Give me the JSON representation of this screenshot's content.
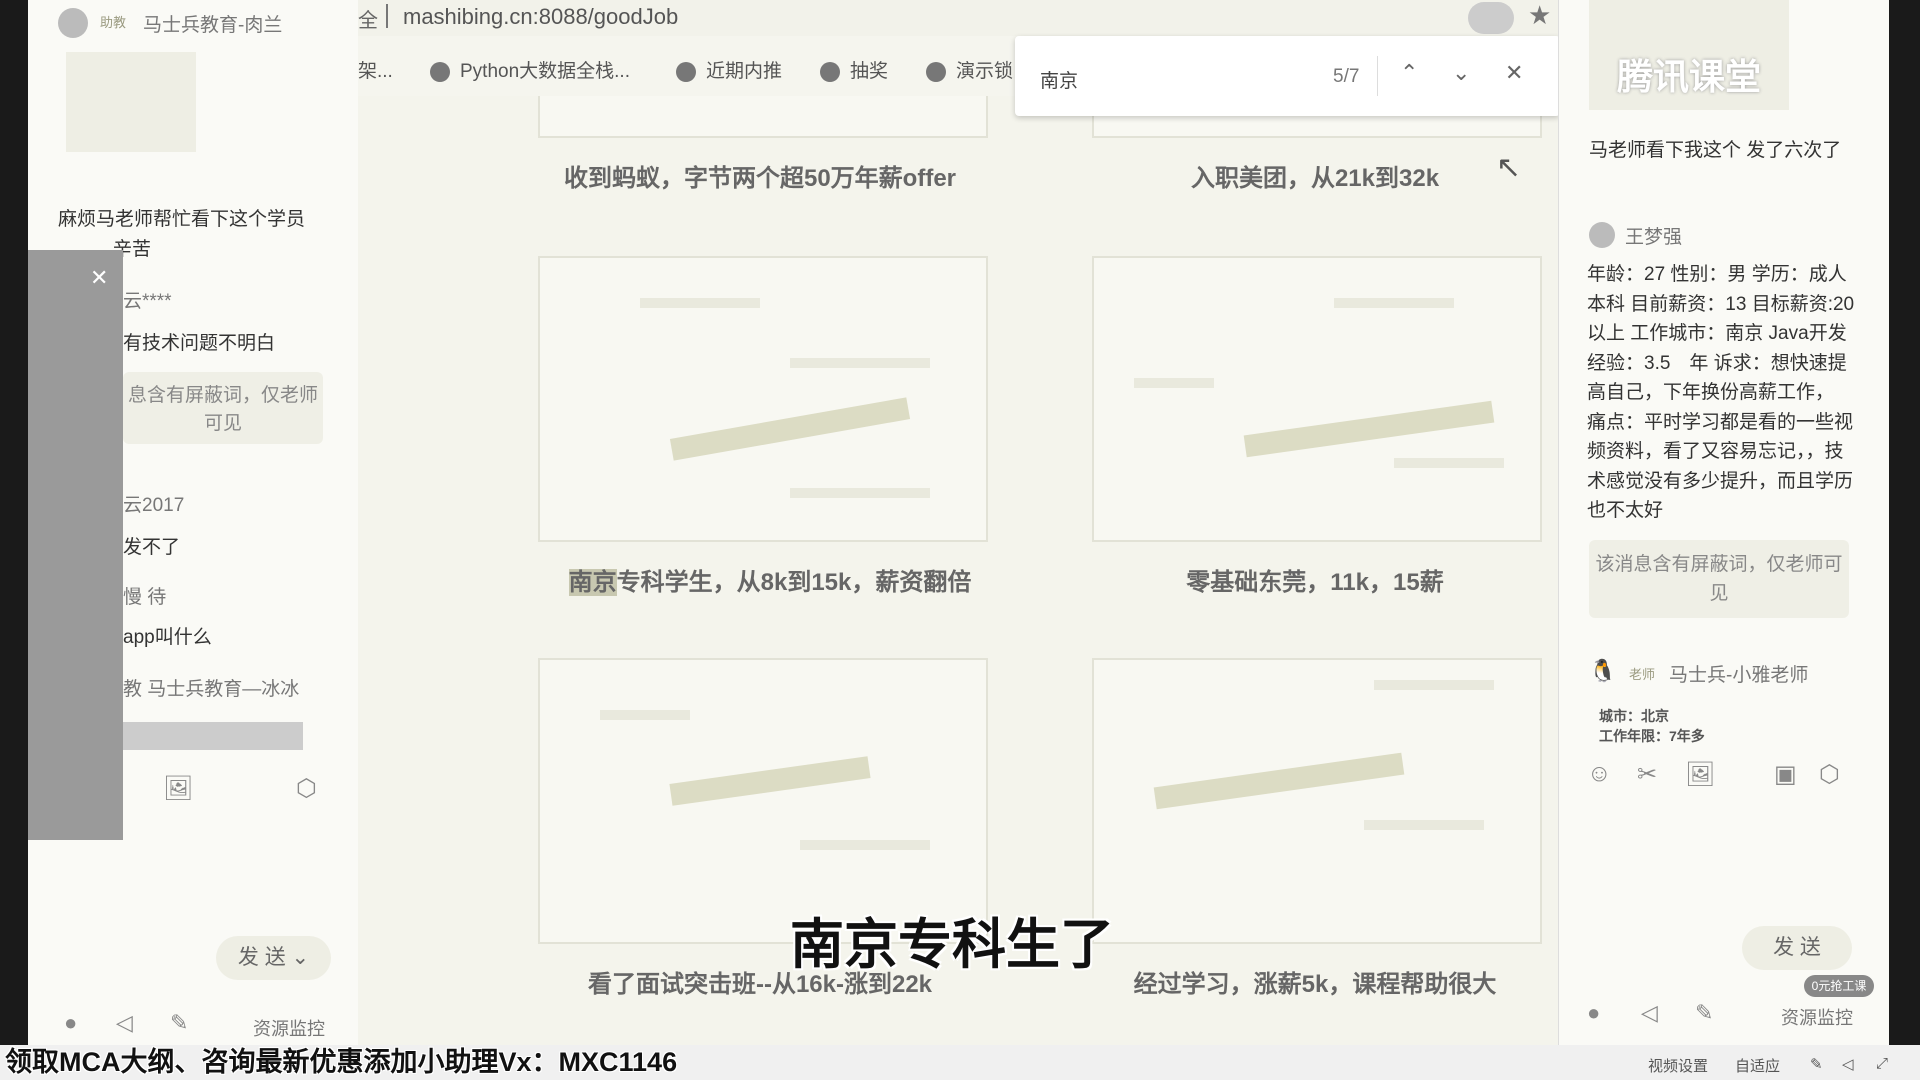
{
  "browser": {
    "url": "mashibing.cn:8088/goodJob",
    "url_prefix": "全",
    "bookmarks": [
      "架...",
      "Python大数据全栈...",
      "近期内推",
      "抽奖",
      "演示锁"
    ],
    "find": {
      "query": "南京",
      "count": "5/7"
    }
  },
  "cards": [
    {
      "caption": "收到蚂蚁，字节两个超50万年薪offer"
    },
    {
      "caption": "入职美团，从21k到32k"
    },
    {
      "caption_hl": "南京",
      "caption": "专科学生，从8k到15k，薪资翻倍"
    },
    {
      "caption": "零基础东莞，11k，15薪"
    },
    {
      "caption": "看了面试突击班--从16k-涨到22k"
    },
    {
      "caption": "经过学习，涨薪5k，课程帮助很大"
    }
  ],
  "left_chat": {
    "header_tag": "助教",
    "header_name": "马士兵教育-肉兰",
    "messages": [
      {
        "text": "麻烦马老师帮忙看下这个学员",
        "text2": "辛苦"
      },
      {
        "name": "云****",
        "text": "有技术问题不明白"
      },
      {
        "shield": "息含有屏蔽词，仅老师可见"
      },
      {
        "name": "云2017",
        "text": "发不了"
      },
      {
        "name": "慢 待",
        "text": "app叫什么"
      },
      {
        "name": "教  马士兵教育—冰冰"
      }
    ],
    "send_label": "发 送",
    "footer_label": "资源监控"
  },
  "right_chat": {
    "watermark": "腾讯课堂",
    "msg1": "马老师看下我这个 发了六次了",
    "user_name": "王梦强",
    "user_msg": "年龄：27 性别：男 学历：成人本科 目前薪资：13 目标薪资:20以上 工作城市：南京 Java开发经验：3.5　年 诉求：想快速提高自己，下年换份高薪工作，　痛点：平时学习都是看的一些视频资料，看了又容易忘记，，技术感觉没有多少提升，而且学历也不太好",
    "shield": "该消息含有屏蔽词，仅老师可见",
    "teacher_tag": "老师",
    "teacher_name": "马士兵-小雅老师",
    "teacher_line1": "城市：北京",
    "teacher_line2": "工作年限：7年多",
    "send_label": "发 送",
    "footer_label": "资源监控",
    "promo": "0元抢工课"
  },
  "subtitle": "南京专科生了",
  "banner": "领取MCA大纲、咨询最新优惠添加小助理Vx：MXC1146",
  "bottom": {
    "video_settings": "视频设置",
    "adapt": "自适应"
  }
}
